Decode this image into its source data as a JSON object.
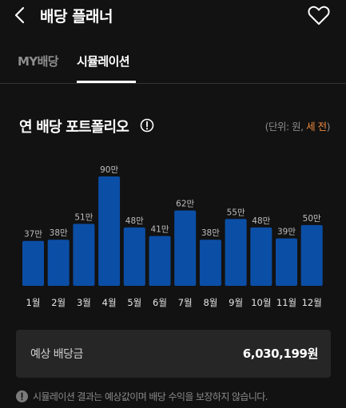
{
  "header": {
    "title": "배당 플래너",
    "back_icon": "chevron-left-icon",
    "favorite_icon": "heart-outline-icon"
  },
  "tabs": [
    {
      "label": "MY배당",
      "active": false
    },
    {
      "label": "시뮬레이션",
      "active": true
    }
  ],
  "section": {
    "title": "연 배당 포트폴리오",
    "info_icon": "info-circle-icon",
    "unit_prefix": "(단위: 원, ",
    "unit_accent": "세 전",
    "unit_suffix": ")"
  },
  "chart_data": {
    "type": "bar",
    "categories": [
      "1월",
      "2월",
      "3월",
      "4월",
      "5월",
      "6월",
      "7월",
      "8월",
      "9월",
      "10월",
      "11월",
      "12월"
    ],
    "values": [
      37,
      38,
      51,
      90,
      48,
      41,
      62,
      38,
      55,
      48,
      39,
      50
    ],
    "value_labels": [
      "37만",
      "38만",
      "51만",
      "90만",
      "48만",
      "41만",
      "62만",
      "38만",
      "55만",
      "48만",
      "39만",
      "50만"
    ],
    "ylim": [
      0,
      90
    ],
    "grid": false,
    "bar_color": "#0b4ea6"
  },
  "summary": {
    "label": "예상 배당금",
    "value": "6,030,199원"
  },
  "disclaimer": {
    "icon": "alert-circle-icon",
    "text": "시뮬레이션 결과는 예상값이며 배당 수익을 보장하지 않습니다."
  },
  "colors": {
    "background": "#121212",
    "accent": "#f08a3c",
    "bar": "#0b4ea6",
    "card": "#262626"
  }
}
